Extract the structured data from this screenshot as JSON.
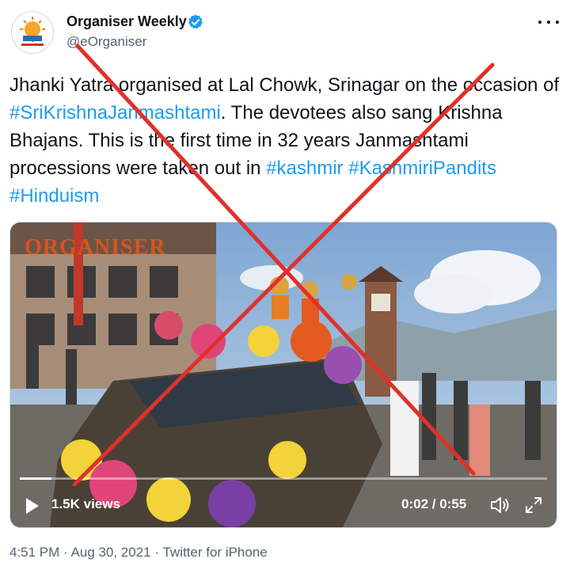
{
  "author": {
    "display_name": "Organiser Weekly",
    "handle": "@eOrganiser",
    "verified_icon": "verified-badge-icon",
    "avatar_icon": "organiser-logo-icon"
  },
  "menu": {
    "more_icon": "more-options-icon"
  },
  "tweet": {
    "text_1": "Jhanki Yatra organised at Lal Chowk, Srinagar on the occasion of ",
    "hashtag_1": "#SriKrishnaJanmashtami",
    "text_2": ". The devotees also sang Krishna Bhajans. This is the first time in 32 years Janmashtami processions were taken out in ",
    "hashtag_2": "#kashmir",
    "hashtag_3": "#KashmiriPandits",
    "hashtag_4": "#Hinduism"
  },
  "video": {
    "watermark": "ORGANISER",
    "views": "1.5K views",
    "time": "0:02 / 0:55",
    "progress": 0.06,
    "play_icon": "play-icon",
    "volume_icon": "volume-icon",
    "fullscreen_icon": "fullscreen-icon"
  },
  "footer": {
    "time": "4:51 PM",
    "date": "Aug 30, 2021",
    "source": "Twitter for iPhone",
    "separator": " · "
  },
  "colors": {
    "link": "#1d9bf0",
    "verified": "#1d9bf0",
    "secondary_text": "#536471",
    "overlay_x": "#e0302a"
  }
}
